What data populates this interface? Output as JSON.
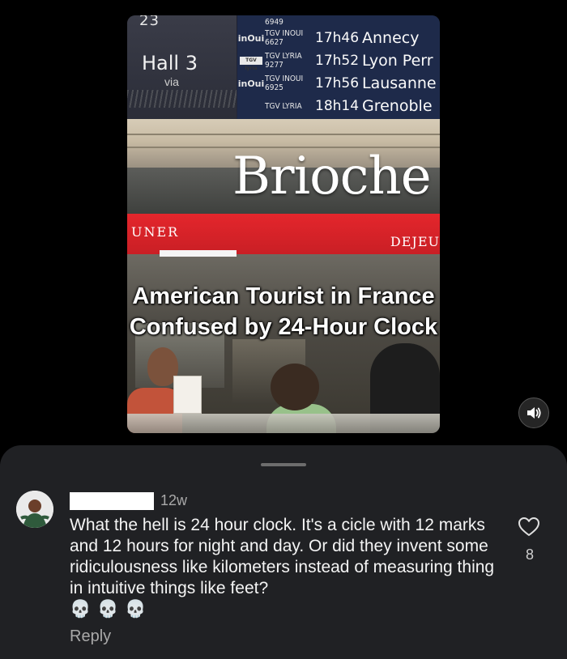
{
  "video": {
    "board": {
      "hall_number": "23",
      "hall_label": "Hall 3",
      "via_label": "via",
      "departures": [
        {
          "brand": "",
          "train": "6949",
          "time": "",
          "destination": ""
        },
        {
          "brand": "inOui",
          "train": "TGV INOUI 6627",
          "time": "17h46",
          "destination": "Annecy"
        },
        {
          "brand": "TGV lyria",
          "train": "TGV LYRIA 9277",
          "time": "17h52",
          "destination": "Lyon Perr"
        },
        {
          "brand": "inOui",
          "train": "TGV INOUI 6925",
          "time": "17h56",
          "destination": "Lausanne"
        },
        {
          "brand": "",
          "train": "TGV LYRIA",
          "time": "18h14",
          "destination": "Grenoble"
        }
      ]
    },
    "shop_name": "Brioche",
    "banner_left": "UNER",
    "banner_right": "DEJEU",
    "caption": "American Tourist in France Confused by 24-Hour Clock"
  },
  "sound_button": {
    "icon": "speaker-volume-icon"
  },
  "comments": [
    {
      "age": "12w",
      "text": "What the hell is 24 hour clock. It's a cicle with 12 marks and 12 hours for night and day. Or did they invent some ridiculousness like kilometers instead of measuring thing in intuitive things like feet?",
      "emoji": "💀💀💀",
      "reply_label": "Reply",
      "like_count": "8"
    }
  ],
  "colors": {
    "sheet_bg": "#202124",
    "banner_red": "#e4262c",
    "board_blue": "#1e2a4a"
  }
}
